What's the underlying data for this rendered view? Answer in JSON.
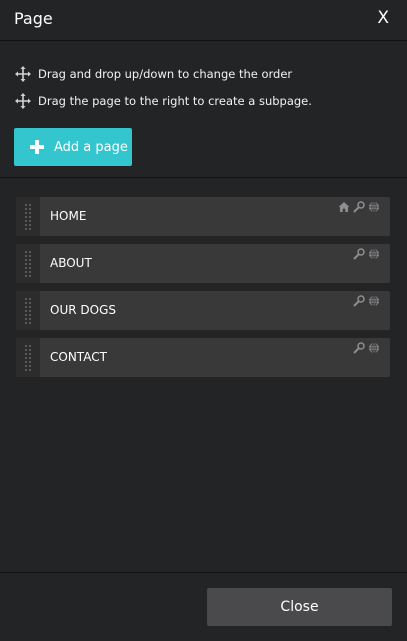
{
  "header": {
    "title": "Page",
    "close_label": "X"
  },
  "hints": [
    {
      "text": "Drag and drop up/down to change the order"
    },
    {
      "text": "Drag the page to the right to create a subpage."
    }
  ],
  "add_button": {
    "label": "Add a page"
  },
  "pages": [
    {
      "name": "HOME",
      "icons": [
        "home-icon",
        "magnifier-icon",
        "globe-icon"
      ]
    },
    {
      "name": "ABOUT",
      "icons": [
        "magnifier-icon",
        "globe-icon"
      ]
    },
    {
      "name": "OUR DOGS",
      "icons": [
        "magnifier-icon",
        "globe-icon"
      ]
    },
    {
      "name": "CONTACT",
      "icons": [
        "magnifier-icon",
        "globe-icon"
      ]
    }
  ],
  "footer": {
    "close_label": "Close"
  },
  "colors": {
    "background": "#232425",
    "accent": "#33c6ce",
    "row": "#39393a",
    "button": "#4a4a4c"
  }
}
